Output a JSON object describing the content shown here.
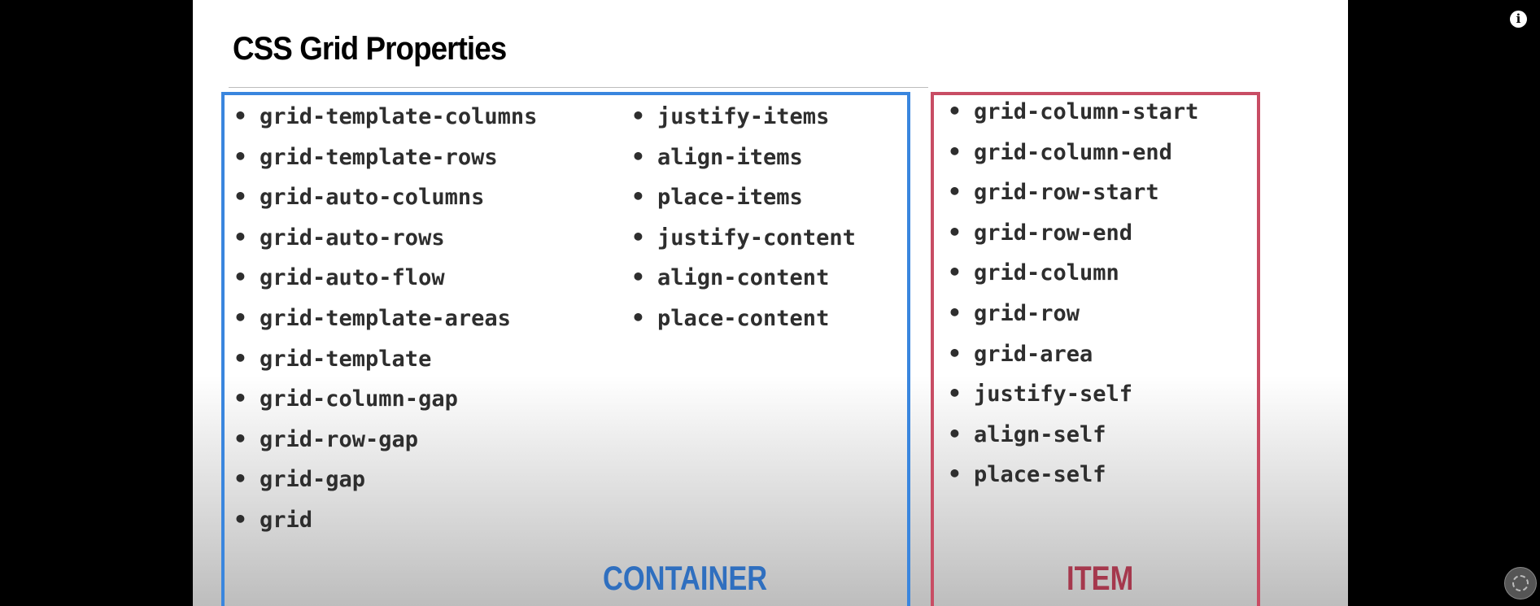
{
  "slide": {
    "title": "CSS Grid Properties",
    "container_label": "CONTAINER",
    "item_label": "ITEM",
    "bullet": "•"
  },
  "container_properties_col1": [
    "grid-template-columns",
    "grid-template-rows",
    "grid-auto-columns",
    "grid-auto-rows",
    "grid-auto-flow",
    "grid-template-areas",
    "grid-template",
    "grid-column-gap",
    "grid-row-gap",
    "grid-gap",
    "grid"
  ],
  "container_properties_col2": [
    "justify-items",
    "align-items",
    "place-items",
    "justify-content",
    "align-content",
    "place-content"
  ],
  "item_properties": [
    "grid-column-start",
    "grid-column-end",
    "grid-row-start",
    "grid-row-end",
    "grid-column",
    "grid-row",
    "grid-area",
    "justify-self",
    "align-self",
    "place-self"
  ],
  "player": {
    "info_icon": "info-icon",
    "info_glyph": "i",
    "channel_logo_icon": "channel-logo-icon"
  },
  "colors": {
    "container_accent": "#3a86de",
    "item_accent": "#c84d64",
    "text": "#2e2e2e"
  }
}
